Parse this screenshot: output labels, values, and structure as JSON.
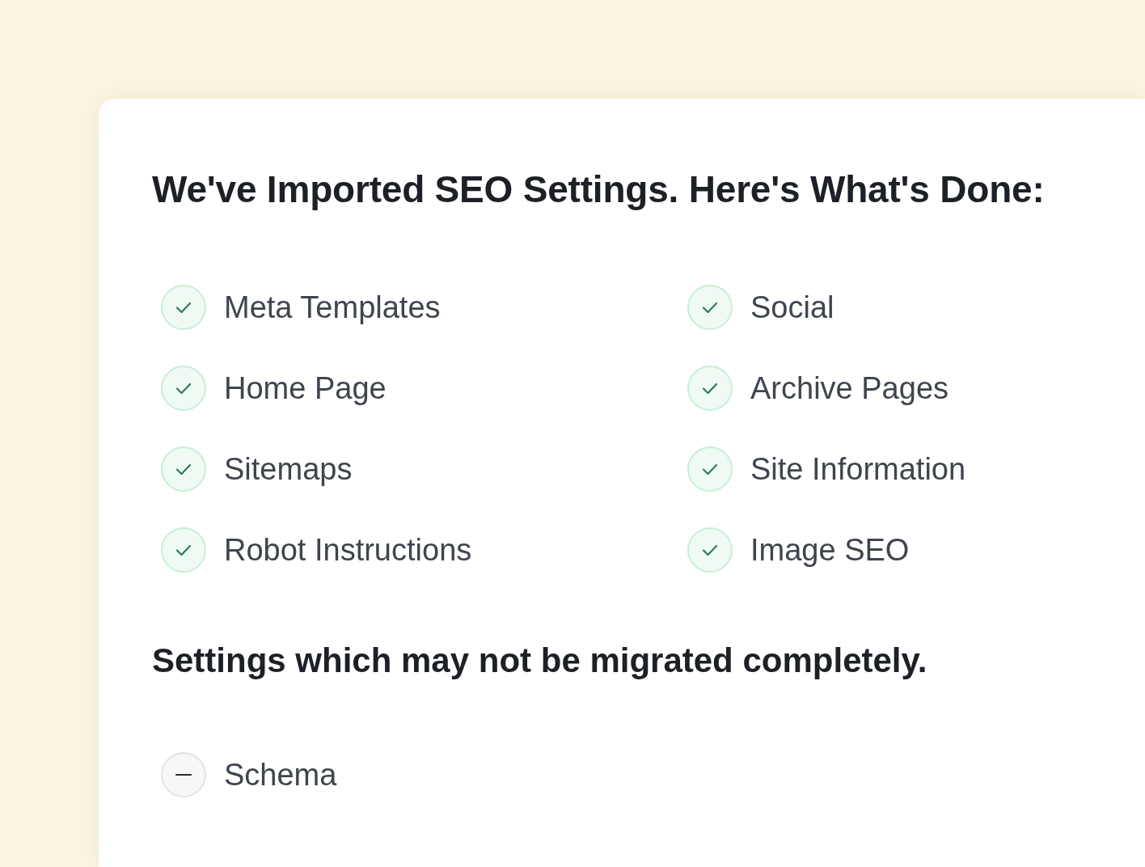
{
  "heading": "We've Imported SEO Settings. Here's What's Done:",
  "imported_items": [
    {
      "label": "Meta Templates",
      "kind": "done"
    },
    {
      "label": "Social",
      "kind": "done"
    },
    {
      "label": "Home Page",
      "kind": "done"
    },
    {
      "label": "Archive Pages",
      "kind": "done"
    },
    {
      "label": "Sitemaps",
      "kind": "done"
    },
    {
      "label": "Site Information",
      "kind": "done"
    },
    {
      "label": "Robot Instructions",
      "kind": "done"
    },
    {
      "label": "Image SEO",
      "kind": "done"
    }
  ],
  "partial_heading": "Settings which may not be migrated completely.",
  "partial_items": [
    {
      "label": "Schema",
      "kind": "partial"
    }
  ]
}
